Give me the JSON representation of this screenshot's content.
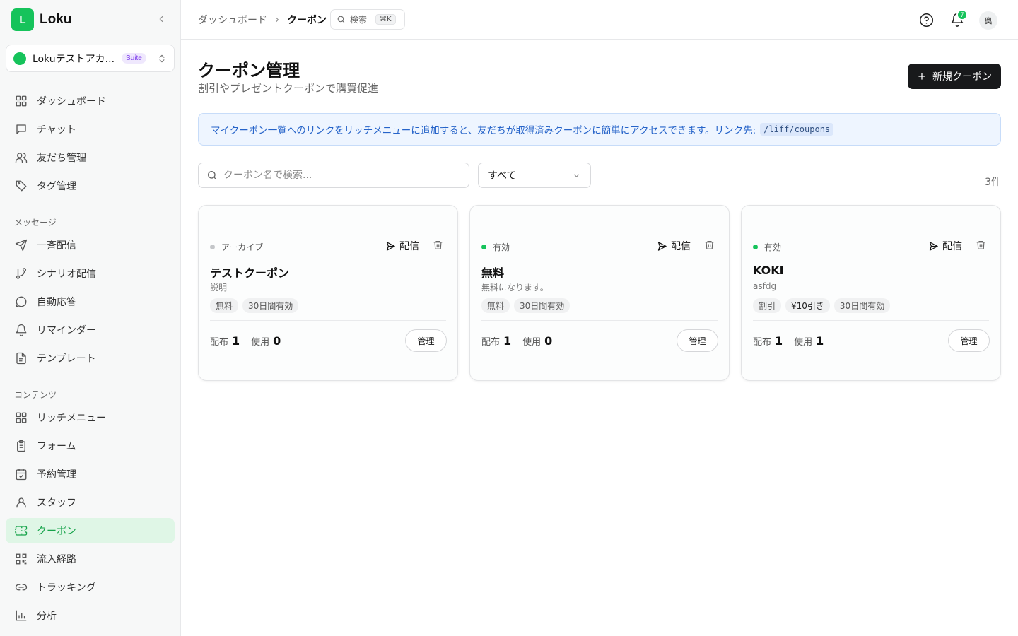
{
  "app": {
    "logo_letter": "L",
    "name": "Loku"
  },
  "account": {
    "name": "Lokuテストアカ...",
    "badge": "Suite"
  },
  "sidebar": {
    "main_items": [
      {
        "label": "ダッシュボード",
        "icon": "grid-icon"
      },
      {
        "label": "チャット",
        "icon": "chat-icon"
      },
      {
        "label": "友だち管理",
        "icon": "users-icon"
      },
      {
        "label": "タグ管理",
        "icon": "tag-icon"
      }
    ],
    "message_section": "メッセージ",
    "message_items": [
      {
        "label": "一斉配信",
        "icon": "send-icon"
      },
      {
        "label": "シナリオ配信",
        "icon": "branch-icon"
      },
      {
        "label": "自動応答",
        "icon": "message-circle-icon"
      },
      {
        "label": "リマインダー",
        "icon": "bell-icon"
      },
      {
        "label": "テンプレート",
        "icon": "file-icon"
      }
    ],
    "content_section": "コンテンツ",
    "content_items": [
      {
        "label": "リッチメニュー",
        "icon": "grid-icon"
      },
      {
        "label": "フォーム",
        "icon": "clipboard-icon"
      },
      {
        "label": "予約管理",
        "icon": "calendar-check-icon"
      },
      {
        "label": "スタッフ",
        "icon": "user-icon"
      },
      {
        "label": "クーポン",
        "icon": "ticket-icon",
        "active": true
      },
      {
        "label": "流入経路",
        "icon": "qr-icon"
      },
      {
        "label": "トラッキング",
        "icon": "link-icon"
      },
      {
        "label": "分析",
        "icon": "bar-chart-icon"
      }
    ]
  },
  "topbar": {
    "breadcrumb_parent": "ダッシュボード",
    "breadcrumb_current": "クーポン",
    "search_label": "検索",
    "search_shortcut": "⌘K",
    "notification_count": "7",
    "avatar_text": "奥"
  },
  "page": {
    "title": "クーポン管理",
    "subtitle": "割引やプレゼントクーポンで購買促進",
    "new_button": "新規クーポン"
  },
  "info": {
    "text": "マイクーポン一覧へのリンクをリッチメニューに追加すると、友だちが取得済みクーポンに簡単にアクセスできます。リンク先:",
    "code": "/liff/coupons"
  },
  "filters": {
    "search_placeholder": "クーポン名で検索...",
    "status_selected": "すべて",
    "count": "3件"
  },
  "colors": {
    "accent": "#16c35b",
    "archived": "#c4c6c9",
    "active": "#16c35b"
  },
  "card_labels": {
    "send": "配信",
    "distributed": "配布",
    "used": "使用",
    "manage": "管理"
  },
  "coupons": [
    {
      "status": "アーカイブ",
      "status_color": "#c4c6c9",
      "title": "テストクーポン",
      "description": "説明",
      "tags": [
        "無料",
        "30日間有効"
      ],
      "distributed": "1",
      "used": "0"
    },
    {
      "status": "有効",
      "status_color": "#16c35b",
      "title": "無料",
      "description": "無料になります。",
      "tags": [
        "無料",
        "30日間有効"
      ],
      "distributed": "1",
      "used": "0"
    },
    {
      "status": "有効",
      "status_color": "#16c35b",
      "title": "KOKI",
      "description": "asfdg",
      "tags": [
        "割引",
        "¥10引き",
        "30日間有効"
      ],
      "distributed": "1",
      "used": "1"
    }
  ]
}
